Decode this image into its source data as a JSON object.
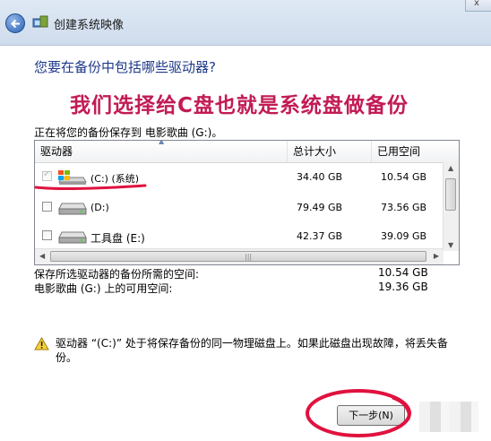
{
  "window": {
    "title": "创建系统映像",
    "close_label": "x"
  },
  "heading": "您要在备份中包括哪些驱动器?",
  "overlay_caption": "我们选择给C盘也就是系统盘做备份",
  "save_target": "正在将您的备份保存到 电影歌曲 (G:)。",
  "table": {
    "columns": [
      "驱动器",
      "总计大小",
      "已用空间"
    ],
    "rows": [
      {
        "name": "(C:) (系统)",
        "size": "34.40 GB",
        "used": "10.54 GB",
        "checked": true,
        "disabled": true,
        "icon": "windows-drive-icon"
      },
      {
        "name": "(D:)",
        "size": "79.49 GB",
        "used": "73.56 GB",
        "checked": false,
        "disabled": false,
        "icon": "hard-drive-icon"
      },
      {
        "name": "工具盘 (E:)",
        "size": "42.37 GB",
        "used": "39.09 GB",
        "checked": false,
        "disabled": false,
        "icon": "hard-drive-icon"
      }
    ]
  },
  "summary": {
    "required_label": "保存所选驱动器的备份所需的空间:",
    "required_value": "10.54 GB",
    "available_label": "电影歌曲 (G:) 上的可用空间:",
    "available_value": "19.36 GB"
  },
  "warning": "驱动器 “(C:)” 处于将保存备份的同一物理磁盘上。如果此磁盘出现故障，将丢失备份。",
  "buttons": {
    "next": "下一步(N)"
  },
  "colors": {
    "annotation_red": "#e0123f",
    "heading_blue": "#1e3a8a",
    "caption_magenta": "#c21b55"
  }
}
